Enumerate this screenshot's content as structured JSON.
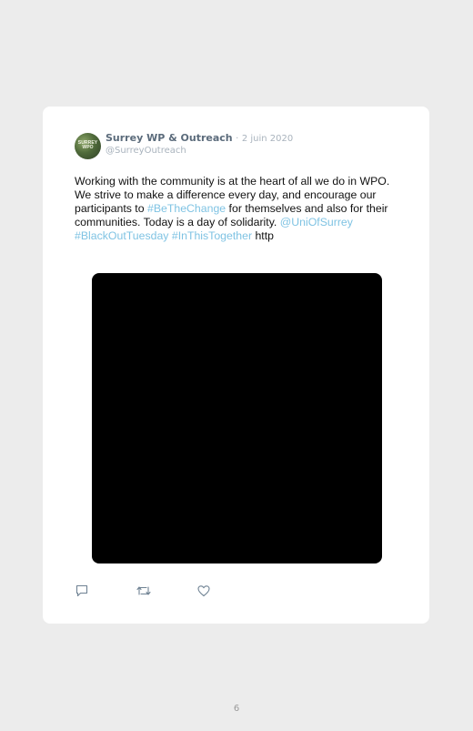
{
  "tweet": {
    "display_name": "Surrey WP & Outreach",
    "separator": "·",
    "date": "2 juin 2020",
    "handle": "@SurreyOutreach",
    "avatar_text": "SURREY WPO",
    "text_segments": [
      {
        "text": "Working with the community is at the heart of all we do in WPO. We strive to make a difference every day, and encourage our participants to ",
        "type": "text"
      },
      {
        "text": "#BeTheChange",
        "type": "hashtag"
      },
      {
        "text": " for themselves and also for their communities. Today is a day of solidarity. ",
        "type": "text"
      },
      {
        "text": "@UniOfSurrey",
        "type": "mention"
      },
      {
        "text": " ",
        "type": "text"
      },
      {
        "text": "#BlackOutTuesday",
        "type": "hashtag"
      },
      {
        "text": " ",
        "type": "text"
      },
      {
        "text": "#InThisTogether",
        "type": "hashtag"
      },
      {
        "text": " http",
        "type": "text"
      }
    ],
    "media": {
      "color": "#000000"
    },
    "actions": [
      {
        "name": "reply-icon"
      },
      {
        "name": "retweet-icon"
      },
      {
        "name": "like-icon"
      }
    ]
  },
  "page_number": "6",
  "colors": {
    "background": "#ececec",
    "card": "#ffffff",
    "link": "#7fc3e3",
    "name": "#5b6b7b",
    "muted": "#a9b3bd"
  }
}
